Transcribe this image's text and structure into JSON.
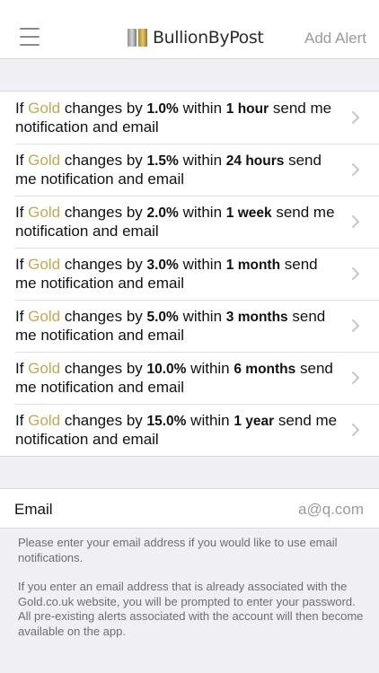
{
  "header": {
    "logo_text": "BullionByPost",
    "add_alert_label": "Add Alert"
  },
  "alerts": [
    {
      "prefix": "If ",
      "metal": "Gold",
      "mid": " changes by ",
      "pct": "1.0%",
      "within": " within ",
      "period": "1 hour",
      "suffix": " send me notification and email"
    },
    {
      "prefix": "If ",
      "metal": "Gold",
      "mid": " changes by ",
      "pct": "1.5%",
      "within": " within ",
      "period": "24 hours",
      "suffix": " send me notification and email"
    },
    {
      "prefix": "If ",
      "metal": "Gold",
      "mid": " changes by ",
      "pct": "2.0%",
      "within": " within ",
      "period": "1 week",
      "suffix": " send me notification and email"
    },
    {
      "prefix": "If ",
      "metal": "Gold",
      "mid": " changes by ",
      "pct": "3.0%",
      "within": " within ",
      "period": "1 month",
      "suffix": " send me notification and email"
    },
    {
      "prefix": "If ",
      "metal": "Gold",
      "mid": " changes by ",
      "pct": "5.0%",
      "within": " within ",
      "period": "3 months",
      "suffix": " send me notification and email"
    },
    {
      "prefix": "If ",
      "metal": "Gold",
      "mid": " changes by ",
      "pct": "10.0%",
      "within": " within ",
      "period": "6 months",
      "suffix": " send me notification and email"
    },
    {
      "prefix": "If ",
      "metal": "Gold",
      "mid": " changes by ",
      "pct": "15.0%",
      "within": " within ",
      "period": "1 year",
      "suffix": " send me notification and email"
    }
  ],
  "email": {
    "label": "Email",
    "value": "a@q.com"
  },
  "footer": {
    "note1": "Please enter your email address if you would like to use email notifications.",
    "note2": "If you enter an email address that is already associated with the Gold.co.uk website, you will be prompted to enter your password. All pre-existing alerts associated with the account will then become available on the app."
  },
  "colors": {
    "gold": "#caa74b",
    "muted": "#9b9b9f",
    "background": "#efeff4"
  },
  "icons": {
    "menu": "hamburger-menu-icon",
    "logo": "gold-bar-logo-icon",
    "row": "chevron-right-icon"
  }
}
